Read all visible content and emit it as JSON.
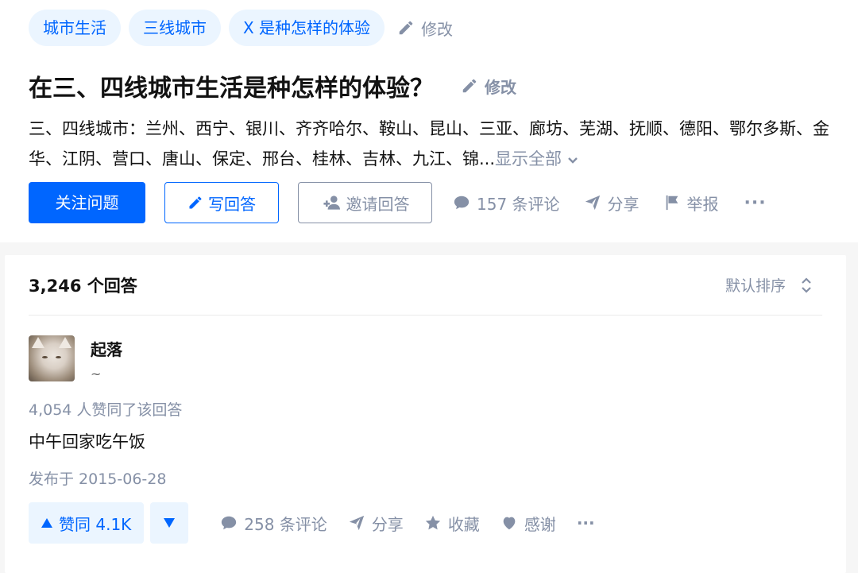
{
  "topics": [
    "城市生活",
    "三线城市",
    "X 是种怎样的体验"
  ],
  "topic_edit_label": "修改",
  "question": {
    "title": "在三、四线城市生活是种怎样的体验？",
    "edit_label": "修改",
    "detail": "三、四线城市：兰州、西宁、银川、齐齐哈尔、鞍山、昆山、三亚、廊坊、芜湖、抚顺、德阳、鄂尔多斯、金华、江阴、营口、唐山、保定、邢台、桂林、吉林、九江、锦...",
    "show_all_label": "显示全部"
  },
  "actions": {
    "follow": "关注问题",
    "write": "写回答",
    "invite": "邀请回答",
    "comments": "157 条评论",
    "share": "分享",
    "report": "举报",
    "more": "···"
  },
  "answer_list": {
    "count_label": "3,246 个回答",
    "sort_label": "默认排序"
  },
  "answer": {
    "author_name": "起落",
    "author_bio": "~",
    "vote_text": "4,054 人赞同了该回答",
    "content": "中午回家吃午饭",
    "published": "发布于 2015-06-28",
    "vote_up": "赞同 4.1K",
    "comments": "258 条评论",
    "share": "分享",
    "collect": "收藏",
    "thanks": "感谢",
    "more": "···"
  },
  "colors": {
    "brand_blue": "#0066ff",
    "light_blue_bg": "#ebf5ff",
    "meta_gray": "#8590a6",
    "page_bg": "#f6f6f6"
  },
  "icons": [
    "pencil-icon",
    "invite-icon",
    "comment-icon",
    "share-icon",
    "flag-icon",
    "sort-icon",
    "chevron-down-icon",
    "triangle-up-icon",
    "triangle-down-icon",
    "star-icon",
    "heart-icon"
  ]
}
